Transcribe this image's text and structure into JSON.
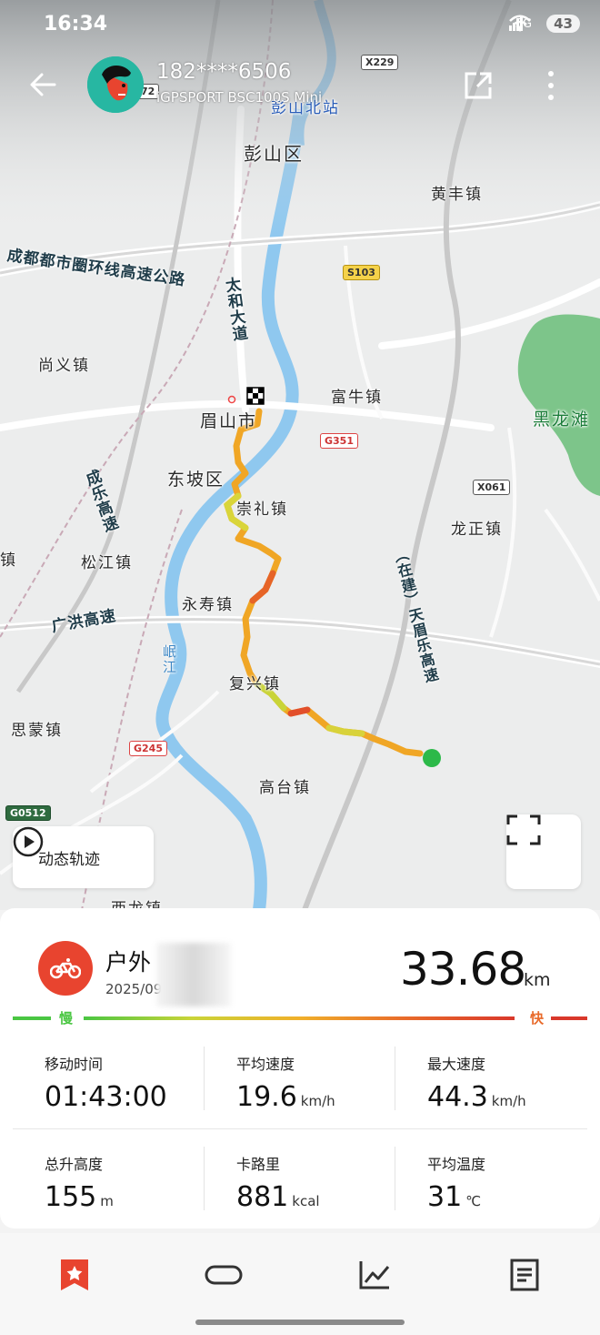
{
  "status_bar": {
    "time": "16:34",
    "network": "5G",
    "battery": "43"
  },
  "header": {
    "username": "182****6506",
    "device": "iGPSPORT BSC100S Mini"
  },
  "map": {
    "places": {
      "pengshan_north_station": "彭山北站",
      "pengshan": "彭山区",
      "huangfeng": "黄丰镇",
      "shangyi": "尚义镇",
      "fuliu": "富牛镇",
      "meishan": "眉山市",
      "heilongtan": "黑龙滩",
      "dongpo": "东坡区",
      "chongli": "崇礼镇",
      "longzheng": "龙正镇",
      "songjiang": "松江镇",
      "zhen_left": "镇",
      "yongshou": "永寿镇",
      "fuxing": "复兴镇",
      "simeng": "思蒙镇",
      "gaotai": "高台镇",
      "xilong": "西龙镇",
      "minjiang": "岷江"
    },
    "roads": {
      "ring": "成都都市圈环线高速公路",
      "taihe": "太和大道",
      "chengle": "成乐高速",
      "guanghong": "广洪高速",
      "tianmeile": "（在建）天眉乐高速"
    },
    "shields": {
      "x229": "X229",
      "s103": "S103",
      "g351": "G351",
      "x061": "X061",
      "g245": "G245",
      "g0512": "G0512",
      "num72": "72"
    }
  },
  "controls": {
    "replay_label": "动态轨迹",
    "fullscreen": "fullscreen-icon"
  },
  "activity": {
    "type": "户外骑行",
    "type_visible": "户外",
    "type_visible2": "行",
    "date": "2025/09",
    "distance": "33.68",
    "distance_unit": "km",
    "slow_label": "慢",
    "fast_label": "快",
    "stats": [
      {
        "label": "移动时间",
        "value": "01:43:00",
        "unit": ""
      },
      {
        "label": "平均速度",
        "value": "19.6",
        "unit": "km/h"
      },
      {
        "label": "最大速度",
        "value": "44.3",
        "unit": "km/h"
      },
      {
        "label": "总升高度",
        "value": "155",
        "unit": "m"
      },
      {
        "label": "卡路里",
        "value": "881",
        "unit": "kcal"
      },
      {
        "label": "平均温度",
        "value": "31",
        "unit": "℃"
      }
    ]
  },
  "tabs": [
    "bookmark-star-icon",
    "link-icon",
    "chart-line-icon",
    "document-icon"
  ],
  "colors": {
    "accent": "#e8442f",
    "slow": "#4ac642",
    "fast": "#e86a2a"
  }
}
